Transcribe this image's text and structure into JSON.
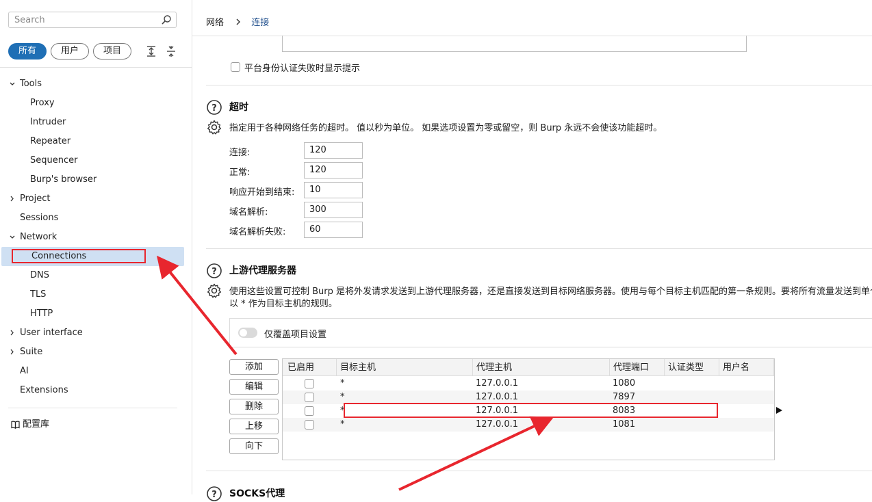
{
  "sidebar": {
    "search_placeholder": "Search",
    "filters": [
      "所有",
      "用户",
      "项目"
    ],
    "items": [
      {
        "label": "Tools",
        "level": 0,
        "chevron": "expanded"
      },
      {
        "label": "Proxy",
        "level": 1
      },
      {
        "label": "Intruder",
        "level": 1
      },
      {
        "label": "Repeater",
        "level": 1
      },
      {
        "label": "Sequencer",
        "level": 1
      },
      {
        "label": "Burp's browser",
        "level": 1
      },
      {
        "label": "Project",
        "level": 0,
        "chevron": "collapsed"
      },
      {
        "label": "Sessions",
        "level": 0
      },
      {
        "label": "Network",
        "level": 0,
        "chevron": "expanded"
      },
      {
        "label": "Connections",
        "level": 1,
        "selected": true
      },
      {
        "label": "DNS",
        "level": 1
      },
      {
        "label": "TLS",
        "level": 1
      },
      {
        "label": "HTTP",
        "level": 1
      },
      {
        "label": "User interface",
        "level": 0,
        "chevron": "collapsed"
      },
      {
        "label": "Suite",
        "level": 0,
        "chevron": "collapsed"
      },
      {
        "label": "AI",
        "level": 0
      },
      {
        "label": "Extensions",
        "level": 0
      }
    ],
    "config_library": "配置库"
  },
  "breadcrumb": {
    "parent": "网络",
    "current": "连接"
  },
  "platform_auth": {
    "checkbox_label": "平台身份认证失败时显示提示",
    "checked": false
  },
  "timeouts": {
    "title": "超时",
    "description": "指定用于各种网络任务的超时。 值以秒为单位。 如果选项设置为零或留空，则 Burp 永远不会使该功能超时。",
    "fields": [
      {
        "label": "连接:",
        "value": "120"
      },
      {
        "label": "正常:",
        "value": "120"
      },
      {
        "label": "响应开始到结束:",
        "value": "10"
      },
      {
        "label": "域名解析:",
        "value": "300"
      },
      {
        "label": "域名解析失败:",
        "value": "60"
      }
    ]
  },
  "upstream": {
    "title": "上游代理服务器",
    "description_line1": "使用这些设置可控制 Burp 是将外发请求发送到上游代理服务器，还是直接发送到目标网络服务器。使用与每个目标主机匹配的第一条规则。要将所有流量发送到单个",
    "description_line2": "以 * 作为目标主机的规则。",
    "override_label": "仅覆盖项目设置",
    "override_on": false,
    "buttons": [
      "添加",
      "编辑",
      "删除",
      "上移",
      "向下"
    ],
    "columns": [
      "已启用",
      "目标主机",
      "代理主机",
      "代理端口",
      "认证类型",
      "用户名"
    ],
    "rows": [
      {
        "enabled": false,
        "target": "*",
        "proxy_host": "127.0.0.1",
        "proxy_port": "1080",
        "auth": "",
        "user": ""
      },
      {
        "enabled": false,
        "target": "*",
        "proxy_host": "127.0.0.1",
        "proxy_port": "7897",
        "auth": "",
        "user": ""
      },
      {
        "enabled": false,
        "target": "*",
        "proxy_host": "127.0.0.1",
        "proxy_port": "8083",
        "auth": "",
        "user": ""
      },
      {
        "enabled": false,
        "target": "*",
        "proxy_host": "127.0.0.1",
        "proxy_port": "1081",
        "auth": "",
        "user": ""
      }
    ]
  },
  "socks": {
    "title": "SOCKS代理"
  },
  "colors": {
    "accent": "#1f6fb5",
    "selected_bg": "#cfe0f3",
    "annotation_red": "#e8262e"
  }
}
